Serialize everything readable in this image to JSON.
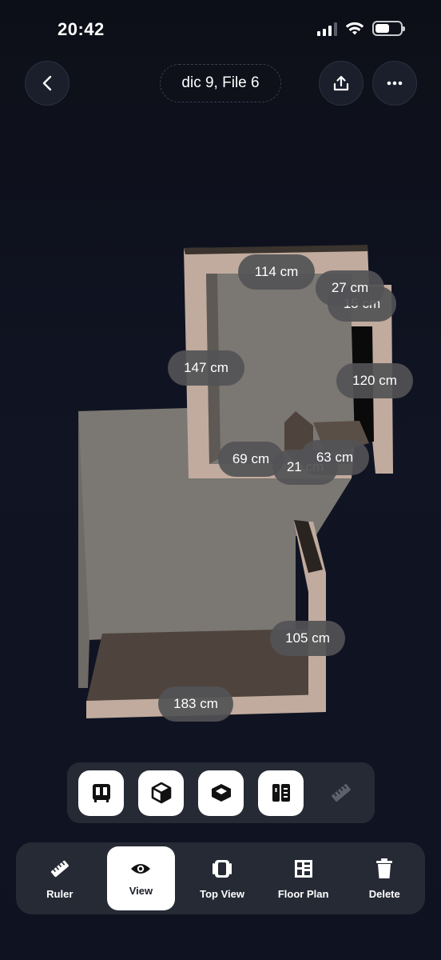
{
  "status_bar": {
    "time": "20:42"
  },
  "nav": {
    "title": "dic 9, File 6"
  },
  "dimensions": {
    "d114": "114 cm",
    "d27": "27 cm",
    "d_hidden": "15 cm",
    "d147": "147 cm",
    "d120": "120 cm",
    "d69": "69 cm",
    "d21": "21 cm",
    "d63": "63 cm",
    "d105": "105 cm",
    "d183": "183 cm"
  },
  "tabs": {
    "ruler": "Ruler",
    "view": "View",
    "top_view": "Top View",
    "floor_plan": "Floor Plan",
    "delete": "Delete"
  },
  "colors": {
    "wall_top": "#c2ada0",
    "floor": "#78746f",
    "dark_floor": "#4d443d",
    "label_bg": "#525256"
  }
}
